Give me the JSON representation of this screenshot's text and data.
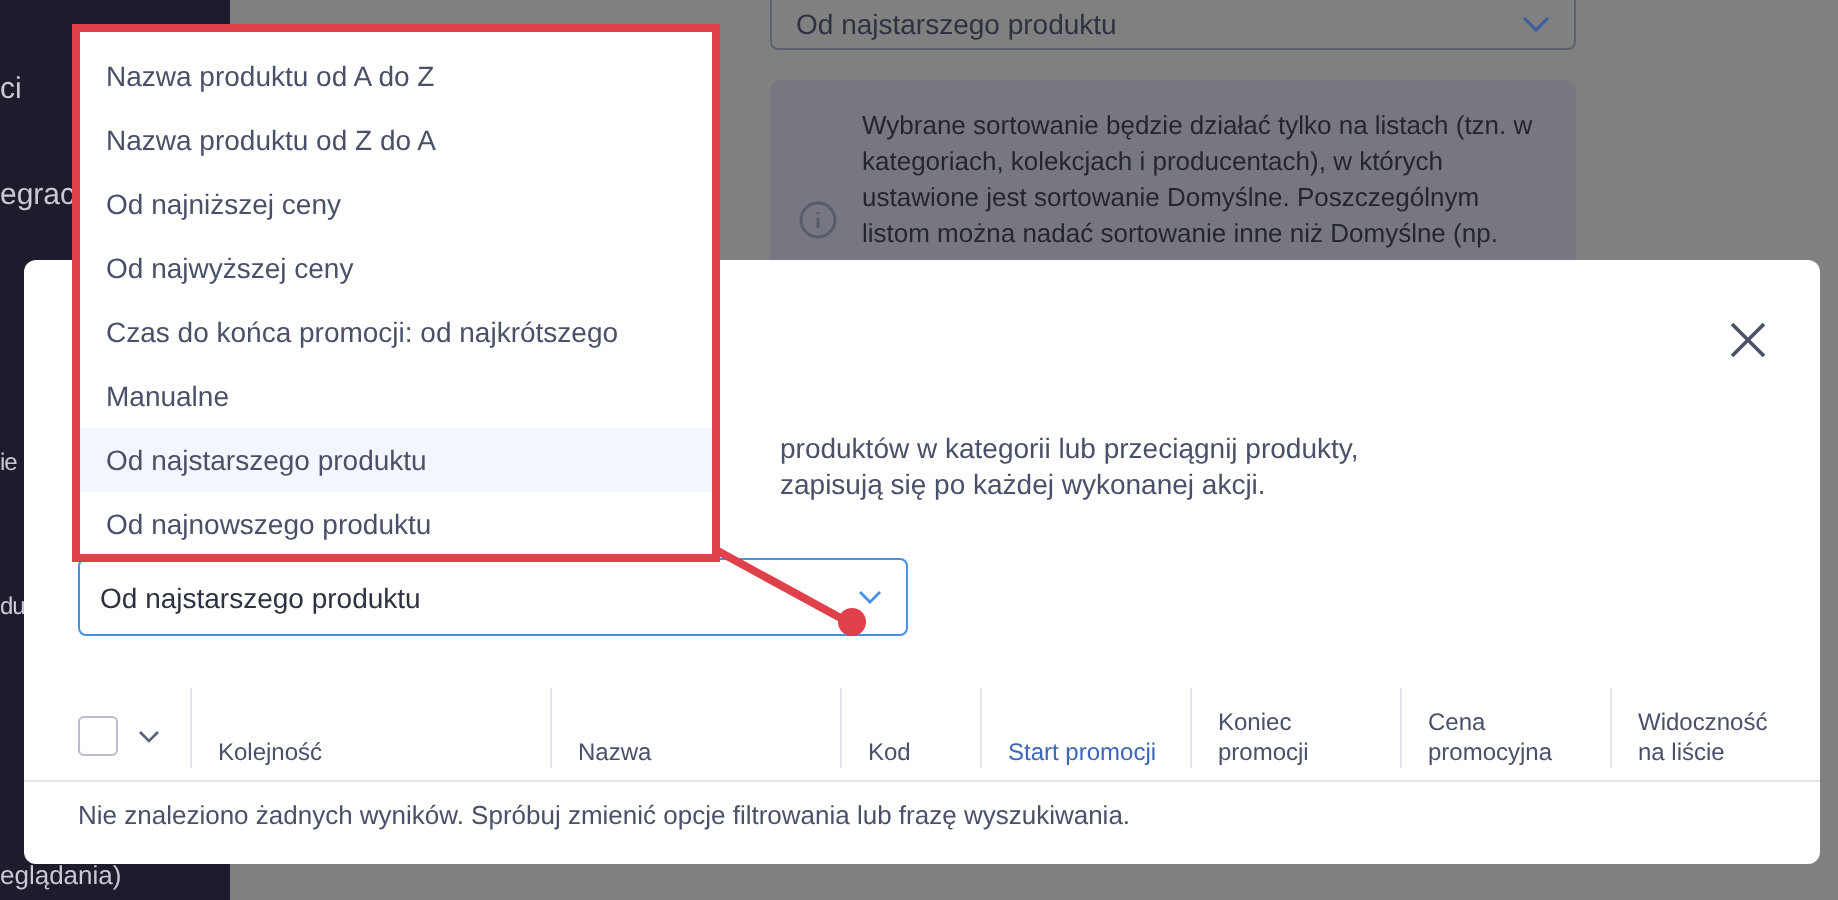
{
  "sidebar": {
    "items": [
      {
        "label": "ci"
      },
      {
        "label": "egrac"
      },
      {
        "label": "ie"
      },
      {
        "label": "du"
      },
      {
        "label": "eglądania)"
      }
    ]
  },
  "background": {
    "sort_select": {
      "value": "Od najstarszego produktu"
    },
    "info": {
      "lines": [
        "Wybrane sortowanie będzie działać tylko na listach (tzn. w",
        "kategoriach, kolekcjach i producentach), w których",
        "ustawione jest sortowanie Domyślne. Poszczególnym",
        "listom można nadać sortowanie inne niż Domyślne (np."
      ]
    }
  },
  "modal": {
    "description_lines": [
      "produktów w kategorii lub przeciągnij produkty,",
      "zapisują się po każdej wykonanej akcji."
    ],
    "sort_select": {
      "value": "Od najstarszego produktu",
      "expanded": true,
      "options": [
        {
          "label": "Nazwa produktu od A do Z",
          "selected": false
        },
        {
          "label": "Nazwa produktu od Z do A",
          "selected": false
        },
        {
          "label": "Od najniższej ceny",
          "selected": false
        },
        {
          "label": "Od najwyższej ceny",
          "selected": false
        },
        {
          "label": "Czas do końca promocji: od najkrótszego",
          "selected": false
        },
        {
          "label": "Manualne",
          "selected": false
        },
        {
          "label": "Od najstarszego produktu",
          "selected": true
        },
        {
          "label": "Od najnowszego produktu",
          "selected": false
        }
      ]
    },
    "table": {
      "select_all_checked": false,
      "columns": [
        {
          "label": "Kolejność",
          "active": false
        },
        {
          "label": "Nazwa",
          "active": false
        },
        {
          "label": "Kod",
          "active": false
        },
        {
          "label": "Start promocji",
          "active": true
        },
        {
          "label": "Koniec promocji",
          "active": false
        },
        {
          "label": "Cena promocyjna",
          "active": false
        },
        {
          "label": "Widoczność na liście",
          "active": false
        }
      ],
      "empty_message": "Nie znaleziono żadnych wyników. Spróbuj zmienić opcje filtrowania lub frazę wyszukiwania."
    }
  }
}
